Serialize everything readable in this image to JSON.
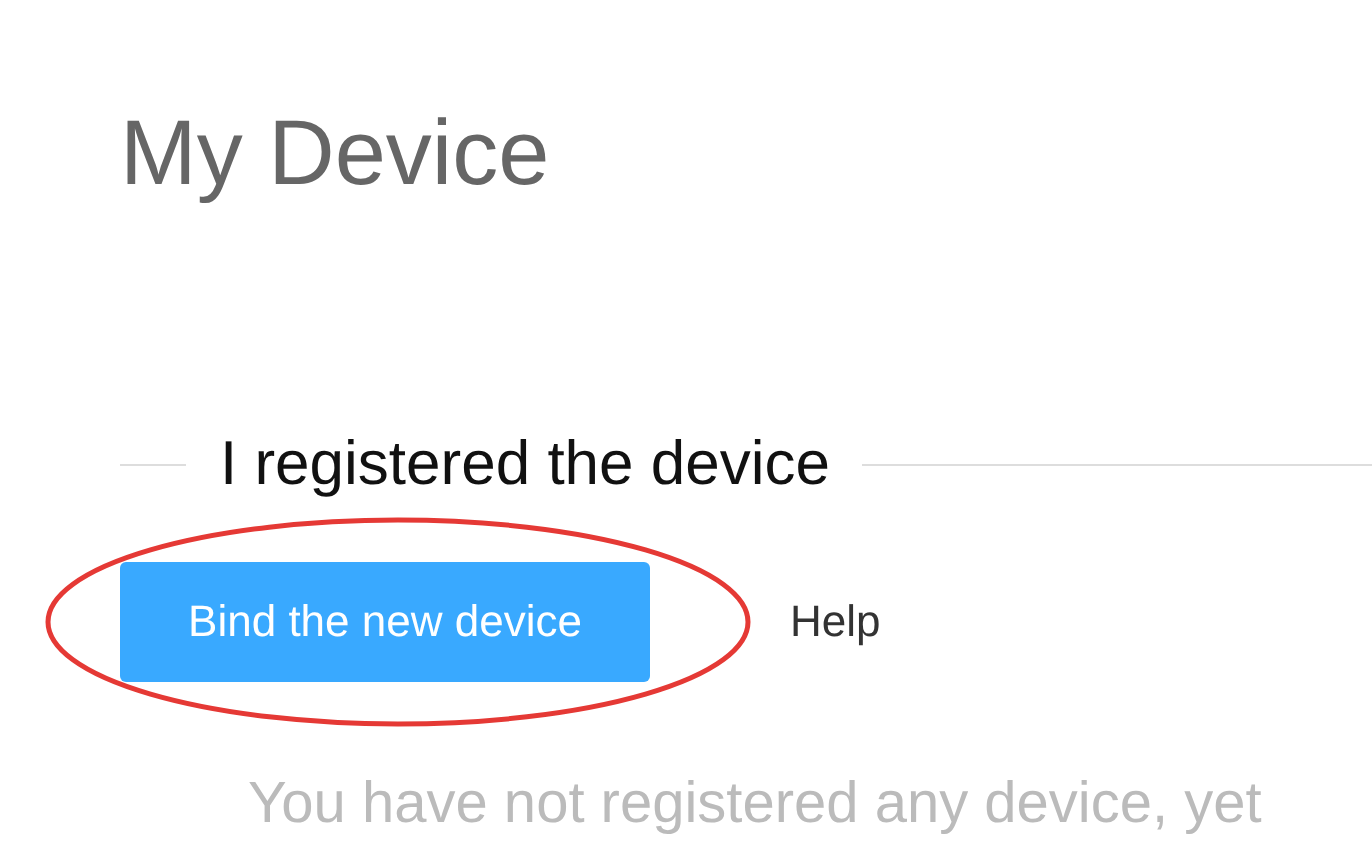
{
  "page_title": "My Device",
  "section": {
    "heading": "I registered the device"
  },
  "actions": {
    "bind_button": "Bind the new device",
    "help_link": "Help",
    "highlighted": true
  },
  "empty_message": "You have not registered any device, yet"
}
